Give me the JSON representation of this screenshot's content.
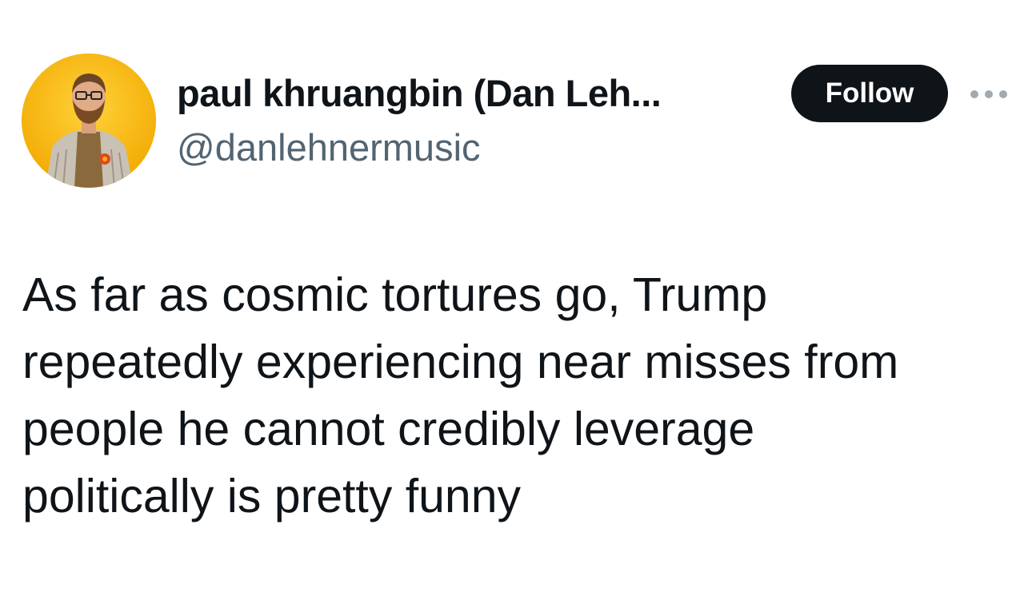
{
  "author": {
    "display_name": "paul khruangbin (Dan Leh...",
    "handle": "@danlehnermusic",
    "avatar_icon": "profile-photo"
  },
  "actions": {
    "follow_label": "Follow",
    "more_icon": "more-horizontal-icon"
  },
  "tweet": {
    "lines": [
      "As far as cosmic tortures go, Trump",
      "repeatedly experiencing near misses from",
      "people he cannot credibly leverage",
      "politically is pretty funny"
    ]
  },
  "colors": {
    "text_primary": "#0f1419",
    "text_secondary": "#536471",
    "button_bg": "#0f1419",
    "button_text": "#ffffff",
    "avatar_bg": "#f5b811"
  }
}
